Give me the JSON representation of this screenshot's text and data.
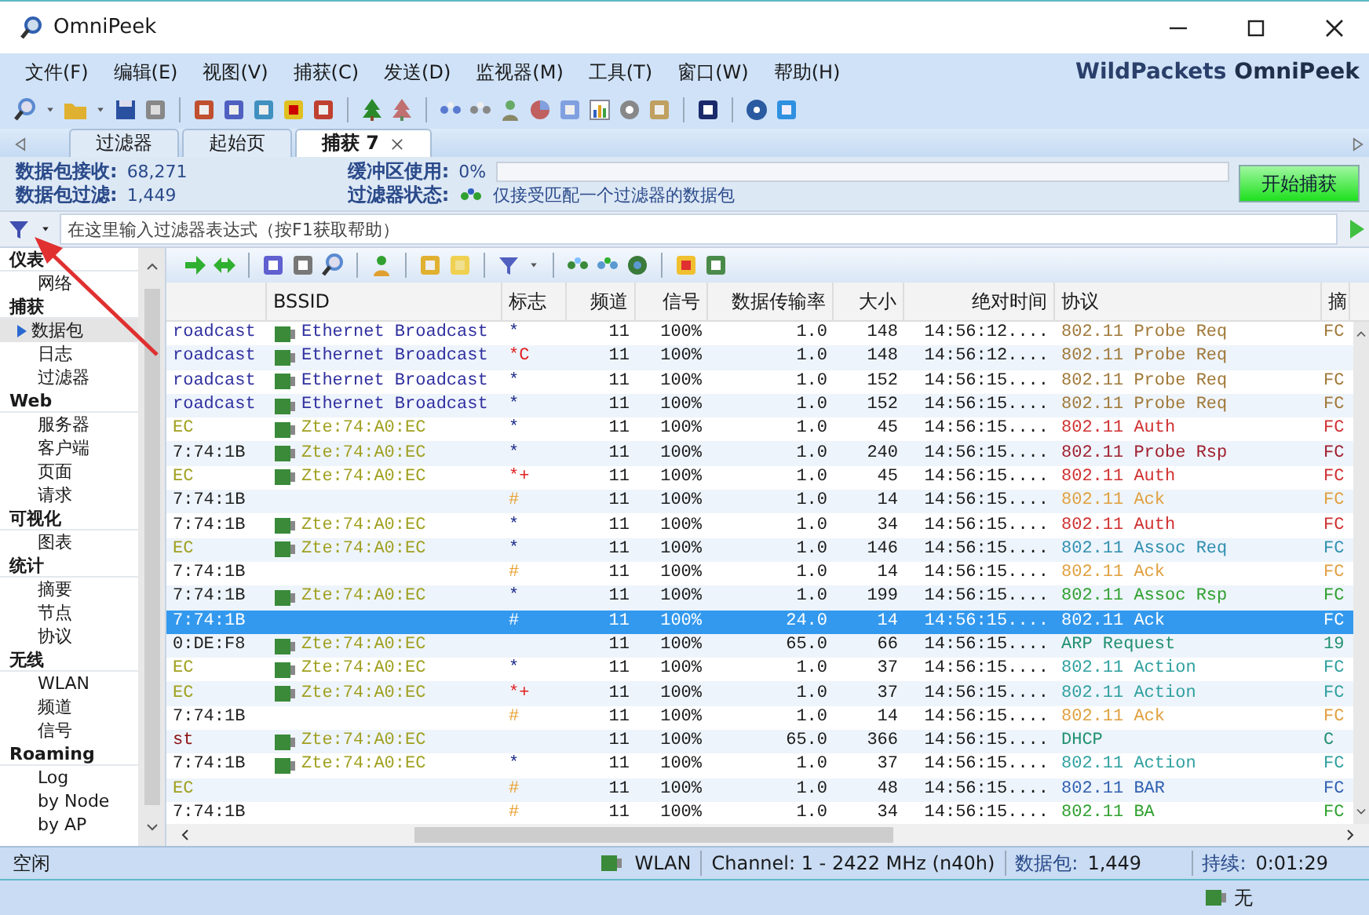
{
  "window": {
    "title": "OmniPeek"
  },
  "menu": [
    "文件(F)",
    "编辑(E)",
    "视图(V)",
    "捕获(C)",
    "发送(D)",
    "监视器(M)",
    "工具(T)",
    "窗口(W)",
    "帮助(H)"
  ],
  "logo": {
    "brand": "WildPackets",
    "product": "OmniPeek"
  },
  "tabs": [
    {
      "label": "过滤器",
      "selected": false,
      "closable": false
    },
    {
      "label": "起始页",
      "selected": false,
      "closable": false
    },
    {
      "label": "捕获 7",
      "selected": true,
      "closable": true
    }
  ],
  "stats": {
    "received_label": "数据包接收:",
    "received": "68,271",
    "filtered_label": "数据包过滤:",
    "filtered": "1,449",
    "buffer_label": "缓冲区使用:",
    "buffer": {
      "text": "0%",
      "level": 0
    },
    "filter_state_label": "过滤器状态:",
    "filter_state": "仅接受匹配一个过滤器的数据包"
  },
  "start_button": "开始捕获",
  "filter_bar": {
    "placeholder": "在这里输入过滤器表达式（按F1获取帮助）"
  },
  "sidebar": [
    {
      "label": "仪表",
      "children": [
        {
          "label": "网络",
          "selected": false
        }
      ]
    },
    {
      "label": "捕获",
      "children": [
        {
          "label": "数据包",
          "selected": true
        },
        {
          "label": "日志",
          "selected": false
        },
        {
          "label": "过滤器",
          "selected": false
        }
      ]
    },
    {
      "label": "Web",
      "children": [
        {
          "label": "服务器",
          "selected": false
        },
        {
          "label": "客户端",
          "selected": false
        },
        {
          "label": "页面",
          "selected": false
        },
        {
          "label": "请求",
          "selected": false
        }
      ]
    },
    {
      "label": "可视化",
      "children": [
        {
          "label": "图表",
          "selected": false
        }
      ]
    },
    {
      "label": "统计",
      "children": [
        {
          "label": "摘要",
          "selected": false
        },
        {
          "label": "节点",
          "selected": false
        },
        {
          "label": "协议",
          "selected": false
        }
      ]
    },
    {
      "label": "无线",
      "children": [
        {
          "label": "WLAN",
          "selected": false
        },
        {
          "label": "频道",
          "selected": false
        },
        {
          "label": "信号",
          "selected": false
        }
      ]
    },
    {
      "label": "Roaming",
      "children": [
        {
          "label": "Log",
          "selected": false
        },
        {
          "label": "by Node",
          "selected": false
        },
        {
          "label": "by AP",
          "selected": false
        }
      ]
    }
  ],
  "table": {
    "columns": [
      "",
      "BSSID",
      "标志",
      "频道",
      "信号",
      "数据传输率",
      "大小",
      "绝对时间",
      "协议",
      "摘"
    ],
    "rows": [
      {
        "selected": false,
        "source": {
          "text": "roadcast",
          "color": "#3030a0"
        },
        "bssid": {
          "text": "Ethernet Broadcast",
          "color": "#3030a0"
        },
        "flag": {
          "text": "*",
          "color": "#1a2a8a"
        },
        "channel": "11",
        "signal": "100%",
        "rate": "1.0",
        "size": "148",
        "time": "14:56:12....",
        "protocol": {
          "text": "802.11 Probe Req",
          "color": "#a07838"
        },
        "summary": "FC"
      },
      {
        "selected": false,
        "source": {
          "text": "roadcast",
          "color": "#3030a0"
        },
        "bssid": {
          "text": "Ethernet Broadcast",
          "color": "#3030a0"
        },
        "flag": {
          "text": "*C",
          "color": "#e02020"
        },
        "channel": "11",
        "signal": "100%",
        "rate": "1.0",
        "size": "148",
        "time": "14:56:12....",
        "protocol": {
          "text": "802.11 Probe Req",
          "color": "#a07838"
        }
      },
      {
        "selected": false,
        "source": {
          "text": "roadcast",
          "color": "#3030a0"
        },
        "bssid": {
          "text": "Ethernet Broadcast",
          "color": "#3030a0"
        },
        "flag": {
          "text": "*",
          "color": "#1a2a8a"
        },
        "channel": "11",
        "signal": "100%",
        "rate": "1.0",
        "size": "152",
        "time": "14:56:15....",
        "protocol": {
          "text": "802.11 Probe Req",
          "color": "#a07838"
        },
        "summary": "FC"
      },
      {
        "selected": false,
        "source": {
          "text": "roadcast",
          "color": "#3030a0"
        },
        "bssid": {
          "text": "Ethernet Broadcast",
          "color": "#3030a0"
        },
        "flag": {
          "text": "*",
          "color": "#1a2a8a"
        },
        "channel": "11",
        "signal": "100%",
        "rate": "1.0",
        "size": "152",
        "time": "14:56:15....",
        "protocol": {
          "text": "802.11 Probe Req",
          "color": "#a07838"
        },
        "summary": "FC"
      },
      {
        "selected": false,
        "source": {
          "text": "EC",
          "color": "#a0a020"
        },
        "bssid": {
          "text": "Zte:74:A0:EC",
          "color": "#a0a020"
        },
        "flag": {
          "text": "*",
          "color": "#1a2a8a"
        },
        "channel": "11",
        "signal": "100%",
        "rate": "1.0",
        "size": "45",
        "time": "14:56:15....",
        "protocol": {
          "text": "802.11 Auth",
          "color": "#d03030"
        },
        "summary": "FC"
      },
      {
        "selected": false,
        "source": {
          "text": "7:74:1B",
          "color": "#202020"
        },
        "bssid": {
          "text": "Zte:74:A0:EC",
          "color": "#a0a020"
        },
        "flag": {
          "text": "*",
          "color": "#1a2a8a"
        },
        "channel": "11",
        "signal": "100%",
        "rate": "1.0",
        "size": "240",
        "time": "14:56:15....",
        "protocol": {
          "text": "802.11 Probe Rsp",
          "color": "#a02030"
        },
        "summary": "FC"
      },
      {
        "selected": false,
        "source": {
          "text": "EC",
          "color": "#a0a020"
        },
        "bssid": {
          "text": "Zte:74:A0:EC",
          "color": "#a0a020"
        },
        "flag": {
          "text": "*+",
          "color": "#e02020"
        },
        "channel": "11",
        "signal": "100%",
        "rate": "1.0",
        "size": "45",
        "time": "14:56:15....",
        "protocol": {
          "text": "802.11 Auth",
          "color": "#d03030"
        },
        "summary": "FC"
      },
      {
        "selected": false,
        "source": {
          "text": "7:74:1B",
          "color": "#202020"
        },
        "flag": {
          "text": "#",
          "color": "#e8a030"
        },
        "channel": "11",
        "signal": "100%",
        "rate": "1.0",
        "size": "14",
        "time": "14:56:15....",
        "protocol": {
          "text": "802.11 Ack",
          "color": "#e0a040"
        },
        "summary": "FC"
      },
      {
        "selected": false,
        "source": {
          "text": "7:74:1B",
          "color": "#202020"
        },
        "bssid": {
          "text": "Zte:74:A0:EC",
          "color": "#a0a020"
        },
        "flag": {
          "text": "*",
          "color": "#1a2a8a"
        },
        "channel": "11",
        "signal": "100%",
        "rate": "1.0",
        "size": "34",
        "time": "14:56:15....",
        "protocol": {
          "text": "802.11 Auth",
          "color": "#d03030"
        },
        "summary": "FC"
      },
      {
        "selected": false,
        "source": {
          "text": "EC",
          "color": "#a0a020"
        },
        "bssid": {
          "text": "Zte:74:A0:EC",
          "color": "#a0a020"
        },
        "flag": {
          "text": "*",
          "color": "#1a2a8a"
        },
        "channel": "11",
        "signal": "100%",
        "rate": "1.0",
        "size": "146",
        "time": "14:56:15....",
        "protocol": {
          "text": "802.11 Assoc Req",
          "color": "#3090b0"
        },
        "summary": "FC"
      },
      {
        "selected": false,
        "source": {
          "text": "7:74:1B",
          "color": "#202020"
        },
        "flag": {
          "text": "#",
          "color": "#e8a030"
        },
        "channel": "11",
        "signal": "100%",
        "rate": "1.0",
        "size": "14",
        "time": "14:56:15....",
        "protocol": {
          "text": "802.11 Ack",
          "color": "#e0a040"
        },
        "summary": "FC"
      },
      {
        "selected": false,
        "source": {
          "text": "7:74:1B",
          "color": "#202020"
        },
        "bssid": {
          "text": "Zte:74:A0:EC",
          "color": "#a0a020"
        },
        "flag": {
          "text": "*",
          "color": "#1a2a8a"
        },
        "channel": "11",
        "signal": "100%",
        "rate": "1.0",
        "size": "199",
        "time": "14:56:15....",
        "protocol": {
          "text": "802.11 Assoc Rsp",
          "color": "#30a030"
        },
        "summary": "FC"
      },
      {
        "selected": true,
        "source": {
          "text": "7:74:1B"
        },
        "flag": {
          "text": "#"
        },
        "channel": "11",
        "signal": "100%",
        "rate": "24.0",
        "size": "14",
        "time": "14:56:15....",
        "protocol": {
          "text": "802.11 Ack"
        },
        "summary": "FC"
      },
      {
        "selected": false,
        "source": {
          "text": "0:DE:F8",
          "color": "#202020"
        },
        "bssid": {
          "text": "Zte:74:A0:EC",
          "color": "#a0a020"
        },
        "channel": "11",
        "signal": "100%",
        "rate": "65.0",
        "size": "66",
        "time": "14:56:15....",
        "protocol": {
          "text": "ARP Request",
          "color": "#209070"
        },
        "summary": "19"
      },
      {
        "selected": false,
        "source": {
          "text": "EC",
          "color": "#a0a020"
        },
        "bssid": {
          "text": "Zte:74:A0:EC",
          "color": "#a0a020"
        },
        "flag": {
          "text": "*",
          "color": "#1a2a8a"
        },
        "channel": "11",
        "signal": "100%",
        "rate": "1.0",
        "size": "37",
        "time": "14:56:15....",
        "protocol": {
          "text": "802.11 Action",
          "color": "#30a0a0"
        },
        "summary": "FC"
      },
      {
        "selected": false,
        "source": {
          "text": "EC",
          "color": "#a0a020"
        },
        "bssid": {
          "text": "Zte:74:A0:EC",
          "color": "#a0a020"
        },
        "flag": {
          "text": "*+",
          "color": "#e02020"
        },
        "channel": "11",
        "signal": "100%",
        "rate": "1.0",
        "size": "37",
        "time": "14:56:15....",
        "protocol": {
          "text": "802.11 Action",
          "color": "#30a0a0"
        },
        "summary": "FC"
      },
      {
        "selected": false,
        "source": {
          "text": "7:74:1B",
          "color": "#202020"
        },
        "flag": {
          "text": "#",
          "color": "#e8a030"
        },
        "channel": "11",
        "signal": "100%",
        "rate": "1.0",
        "size": "14",
        "time": "14:56:15....",
        "protocol": {
          "text": "802.11 Ack",
          "color": "#e0a040"
        },
        "summary": "FC"
      },
      {
        "selected": false,
        "source": {
          "text": "st",
          "color": "#8b1010"
        },
        "bssid": {
          "text": "Zte:74:A0:EC",
          "color": "#a0a020"
        },
        "channel": "11",
        "signal": "100%",
        "rate": "65.0",
        "size": "366",
        "time": "14:56:15....",
        "protocol": {
          "text": "DHCP",
          "color": "#209070"
        },
        "summary": "C"
      },
      {
        "selected": false,
        "source": {
          "text": "7:74:1B",
          "color": "#202020"
        },
        "bssid": {
          "text": "Zte:74:A0:EC",
          "color": "#a0a020"
        },
        "flag": {
          "text": "*",
          "color": "#1a2a8a"
        },
        "channel": "11",
        "signal": "100%",
        "rate": "1.0",
        "size": "37",
        "time": "14:56:15....",
        "protocol": {
          "text": "802.11 Action",
          "color": "#30a0a0"
        },
        "summary": "FC"
      },
      {
        "selected": false,
        "source": {
          "text": "EC",
          "color": "#a0a020"
        },
        "flag": {
          "text": "#",
          "color": "#e8a030"
        },
        "channel": "11",
        "signal": "100%",
        "rate": "1.0",
        "size": "48",
        "time": "14:56:15....",
        "protocol": {
          "text": "802.11 BAR",
          "color": "#3060b0"
        },
        "summary": "FC"
      },
      {
        "selected": false,
        "source": {
          "text": "7:74:1B",
          "color": "#202020"
        },
        "flag": {
          "text": "#",
          "color": "#e8a030"
        },
        "channel": "11",
        "signal": "100%",
        "rate": "1.0",
        "size": "34",
        "time": "14:56:15....",
        "protocol": {
          "text": "802.11 BA",
          "color": "#30a030"
        },
        "summary": "FC"
      }
    ]
  },
  "status_bar": {
    "state": "空闲",
    "adapter": "WLAN",
    "channel": "Channel: 1 - 2422 MHz (n40h)",
    "packets_label": "数据包:",
    "packets": "1,449",
    "duration_label": "持续:",
    "duration": "0:01:29"
  },
  "bottom_bar": {
    "adapter_state": "无"
  }
}
